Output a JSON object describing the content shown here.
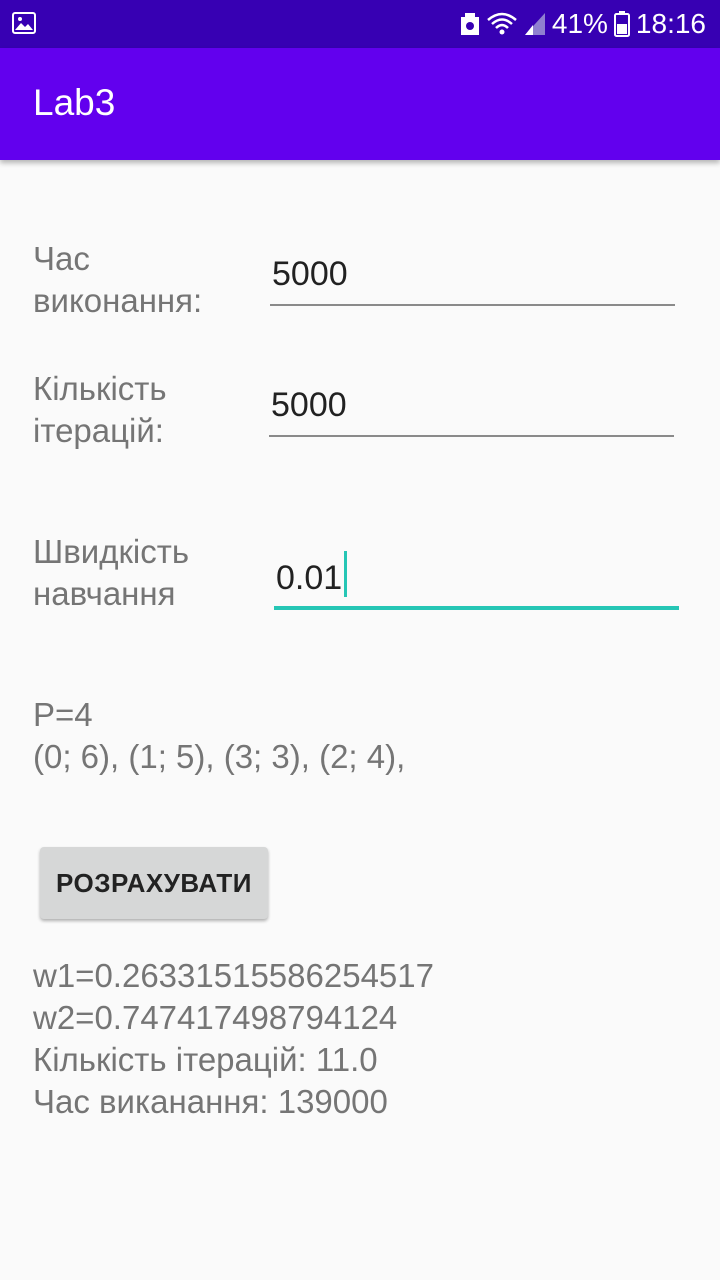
{
  "status_bar": {
    "battery_percent": "41%",
    "time": "18:16",
    "icons": [
      "image-icon",
      "storage-icon",
      "wifi-icon",
      "signal-icon",
      "battery-icon"
    ]
  },
  "app_bar": {
    "title": "Lab3",
    "color": "#6200ee",
    "status_color": "#3700b3"
  },
  "form": {
    "time_label": "Час виконання:",
    "time_value": "5000",
    "iterations_label": "Кількість ітерацій:",
    "iterations_value": "5000",
    "learning_rate_label": "Швидкість навчання",
    "learning_rate_value": "0.01",
    "accent_color": "#26c6b5"
  },
  "info": {
    "p_line": "P=4",
    "points_line": "(0; 6), (1; 5), (3; 3), (2; 4),"
  },
  "button": {
    "calculate_label": "РОЗРАХУВАТИ"
  },
  "results": {
    "w1": "w1=0.26331515586254517",
    "w2": "w2=0.747417498794124",
    "iterations": "Кількість ітерацій: 11.0",
    "time": "Час виканання: 139000"
  }
}
